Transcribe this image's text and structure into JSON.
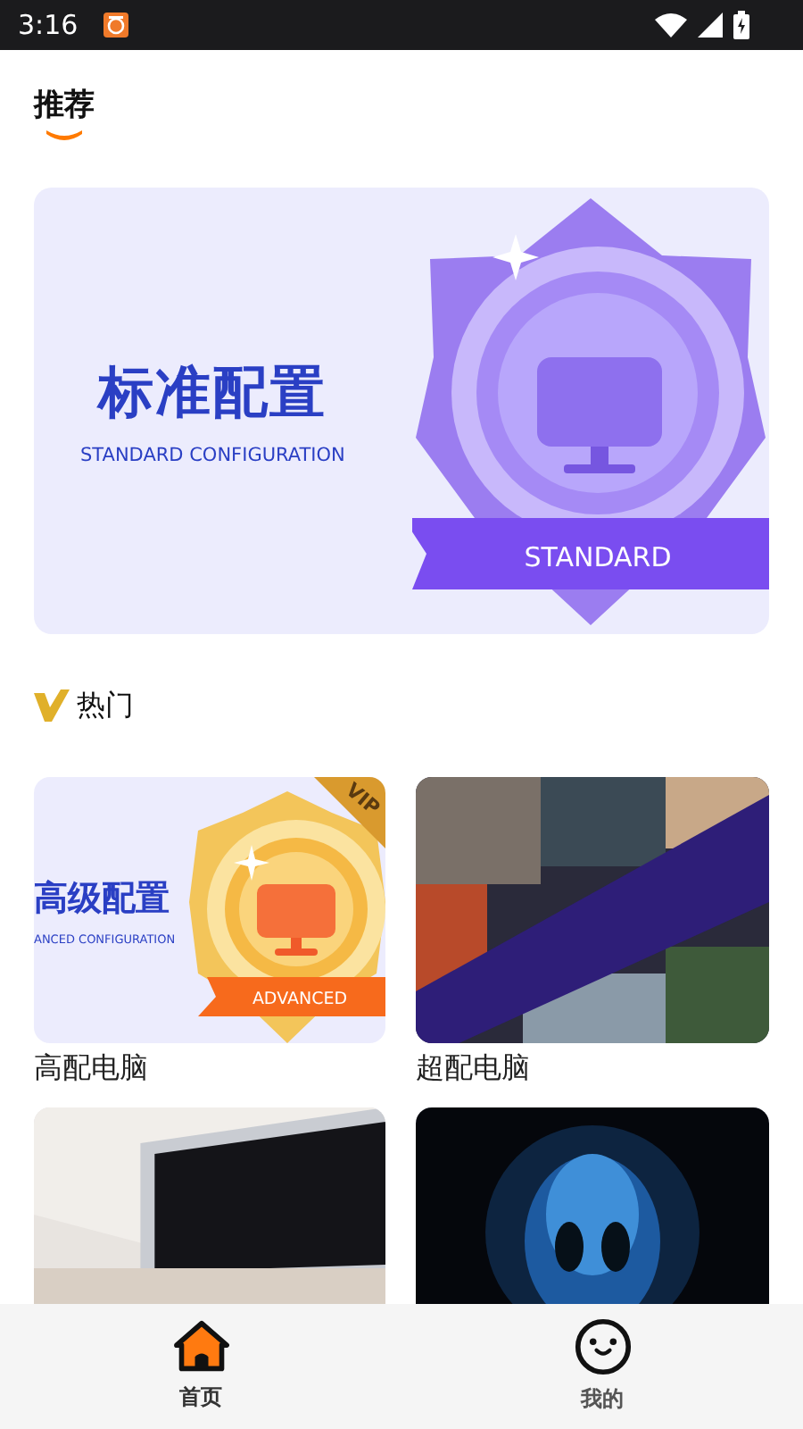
{
  "status_bar": {
    "time": "3:16"
  },
  "recommend": {
    "title": "推荐",
    "banner": {
      "title": "标准配置",
      "subtitle": "STANDARD CONFIGURATION",
      "badge": "STANDARD"
    }
  },
  "hot": {
    "title": "热门",
    "cards": [
      {
        "kind": "badge",
        "title": "高级配置",
        "subtitle": "ANCED CONFIGURATION",
        "badge": "ADVANCED",
        "corner": "VIP",
        "label": "高配电脑"
      },
      {
        "kind": "picture",
        "label": "超配电脑"
      },
      {
        "kind": "picture"
      },
      {
        "kind": "picture"
      }
    ]
  },
  "nav": [
    {
      "kind": "home",
      "label": "首页",
      "selected": true
    },
    {
      "kind": "face",
      "label": "我的",
      "selected": false
    }
  ]
}
